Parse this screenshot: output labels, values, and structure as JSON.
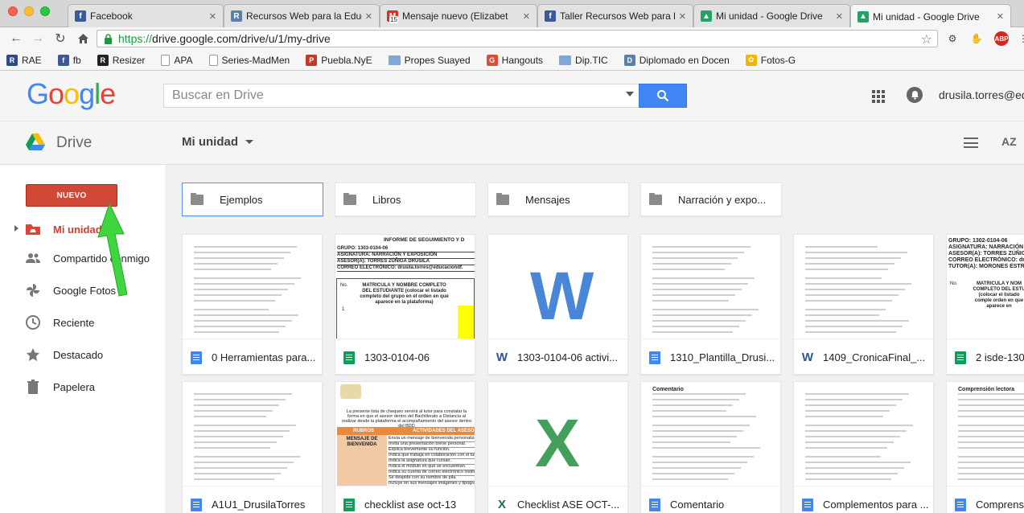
{
  "browser": {
    "tabs": [
      {
        "label": "Facebook",
        "icon": "facebook-icon",
        "color": "#3b5998",
        "glyph": "f"
      },
      {
        "label": "Recursos Web para la Educ",
        "icon": "site-icon",
        "color": "#5a7fa8",
        "glyph": "R"
      },
      {
        "label": "Mensaje nuevo (Elizabet",
        "icon": "gmail-icon",
        "color": "#d93025",
        "glyph": "M"
      },
      {
        "label": "Taller Recursos Web para la",
        "icon": "facebook-icon",
        "color": "#3b5998",
        "glyph": "f"
      },
      {
        "label": "Mi unidad - Google Drive",
        "icon": "drive-icon",
        "color": "#1fa463",
        "glyph": "▲"
      },
      {
        "label": "Mi unidad - Google Drive",
        "icon": "drive-icon",
        "color": "#1fa463",
        "glyph": "▲"
      }
    ],
    "gmail_badge": "15",
    "url_protocol": "https://",
    "url_rest": "drive.google.com/drive/u/1/my-drive",
    "extensions": {
      "abp": "ABP"
    }
  },
  "bookmarks": [
    {
      "label": "RAE",
      "type": "icon",
      "color": "#2d4b8a",
      "glyph": "R"
    },
    {
      "label": "fb",
      "type": "icon",
      "color": "#3b5998",
      "glyph": "f"
    },
    {
      "label": "Resizer",
      "type": "icon",
      "color": "#222222",
      "glyph": "R"
    },
    {
      "label": "APA",
      "type": "page"
    },
    {
      "label": "Series-MadMen",
      "type": "page"
    },
    {
      "label": "Puebla.NyE",
      "type": "icon",
      "color": "#c0392b",
      "glyph": "P"
    },
    {
      "label": "Propes Suayed",
      "type": "folder"
    },
    {
      "label": "Hangouts",
      "type": "icon",
      "color": "#dd4b39",
      "glyph": "G"
    },
    {
      "label": "Dip.TIC",
      "type": "folder"
    },
    {
      "label": "Diplomado en Docen",
      "type": "icon",
      "color": "#5a7fa8",
      "glyph": "D"
    },
    {
      "label": "Fotos-G",
      "type": "icon",
      "color": "#f4b400",
      "glyph": "✿"
    }
  ],
  "header": {
    "search_placeholder": "Buscar en Drive",
    "user_email": "drusila.torres@edu"
  },
  "drive": {
    "app_name": "Drive",
    "location": "Mi unidad",
    "sort_label": "AZ"
  },
  "sidebar": {
    "new_button": "NUEVO",
    "items": [
      {
        "label": "Mi unidad",
        "icon": "my-drive-icon",
        "active": true
      },
      {
        "label": "Compartido conmigo",
        "icon": "shared-people-icon",
        "active": false
      },
      {
        "label": "Google Fotos",
        "icon": "photos-pinwheel-icon",
        "active": false
      },
      {
        "label": "Reciente",
        "icon": "clock-icon",
        "active": false
      },
      {
        "label": "Destacado",
        "icon": "star-icon",
        "active": false
      },
      {
        "label": "Papelera",
        "icon": "trash-icon",
        "active": false
      }
    ]
  },
  "folders": [
    {
      "label": "Ejemplos"
    },
    {
      "label": "Libros"
    },
    {
      "label": "Mensajes"
    },
    {
      "label": "Narración y expo..."
    }
  ],
  "files_row1": [
    {
      "label": "0 Herramientas para...",
      "type": "doc",
      "thumb": "text"
    },
    {
      "label": "1303-0104-06",
      "type": "sheet",
      "thumb": "report"
    },
    {
      "label": "1303-0104-06 activi...",
      "type": "word",
      "thumb": "word"
    },
    {
      "label": "1310_Plantilla_Drusi...",
      "type": "doc",
      "thumb": "text"
    },
    {
      "label": "1409_CronicaFinal_...",
      "type": "word",
      "thumb": "text"
    },
    {
      "label": "2 isde-130",
      "type": "sheet",
      "thumb": "report2"
    }
  ],
  "files_row2": [
    {
      "label": "A1U1_DrusilaTorres",
      "type": "doc",
      "thumb": "text"
    },
    {
      "label": "checklist ase oct-13",
      "type": "sheet",
      "thumb": "checklist"
    },
    {
      "label": "Checklist ASE OCT-...",
      "type": "xls",
      "thumb": "excel"
    },
    {
      "label": "Comentario",
      "type": "doc",
      "thumb": "text"
    },
    {
      "label": "Complementos para ...",
      "type": "doc",
      "thumb": "text"
    },
    {
      "label": "Comprens",
      "type": "doc",
      "thumb": "text"
    }
  ],
  "thumb_text": {
    "report_title": "INFORME DE SEGUIMIENTO Y D",
    "report_lines": [
      "GRUPO:   1303-0104-06",
      "ASIGNATURA: NARRACIÓN Y EXPOSICIÓN",
      "ASESOR(A):  TORRES ZÚÑIGA DRUSILA",
      "CORREO ELECTRÓNICO: drusila.torres@educaciondf."
    ],
    "report_no": "No.",
    "report_col": "MATRICULA Y NOMBRE COMPLETO DEL ESTUDIANTE (colocar el listado completo del grupo en el orden en que aparece en la plataforma)",
    "report_row1": "1",
    "report2_lines": [
      "GRUPO:  1302-0104-06",
      "ASIGNATURA: NARRACIÓN Y",
      "ASESOR(A):  TORRES ZÚÑIGA DR",
      "CORREO ELECTRÓNICO: drusila.torr",
      "TUTOR(A):  MORONES ESTRADA E"
    ],
    "report2_col": "MATRICULA Y NOM COMPLETO DEL ESTU (colocar el listado comple orden en que aparece en",
    "report2_no": "No.",
    "checklist_header": "RUBROS",
    "checklist_header2": "ACTIVIDADES DEL ASESOR",
    "checklist_cell": "MENSAJE DE BIENVENIDA",
    "checklist_items": [
      "Envía un mensaje de bienvenida personalizado.",
      "Invita una presentación breve personal.",
      "Explica brevemente su función.",
      "Indica que trabaja en colaboración con el tutor.",
      "Indica la asignatura que cursan.",
      "Indica el módulo en que se encuentran.",
      "Indica su cuenta de correo electrónico institucional.",
      "Se despide con su nombre de pila.",
      "Incluye en sus mensajes imágenes y tipografía..."
    ],
    "checklist_title": "La presente lista de chequeo servirá al tutor para constatar la forma en que el asesor dentro del Bachillerato a Distancia al realizar desde la plataforma el acompañamiento del asesor dentro del BDD",
    "comentario_title": "Comentario",
    "comp_title": "Comprensión lectora"
  }
}
